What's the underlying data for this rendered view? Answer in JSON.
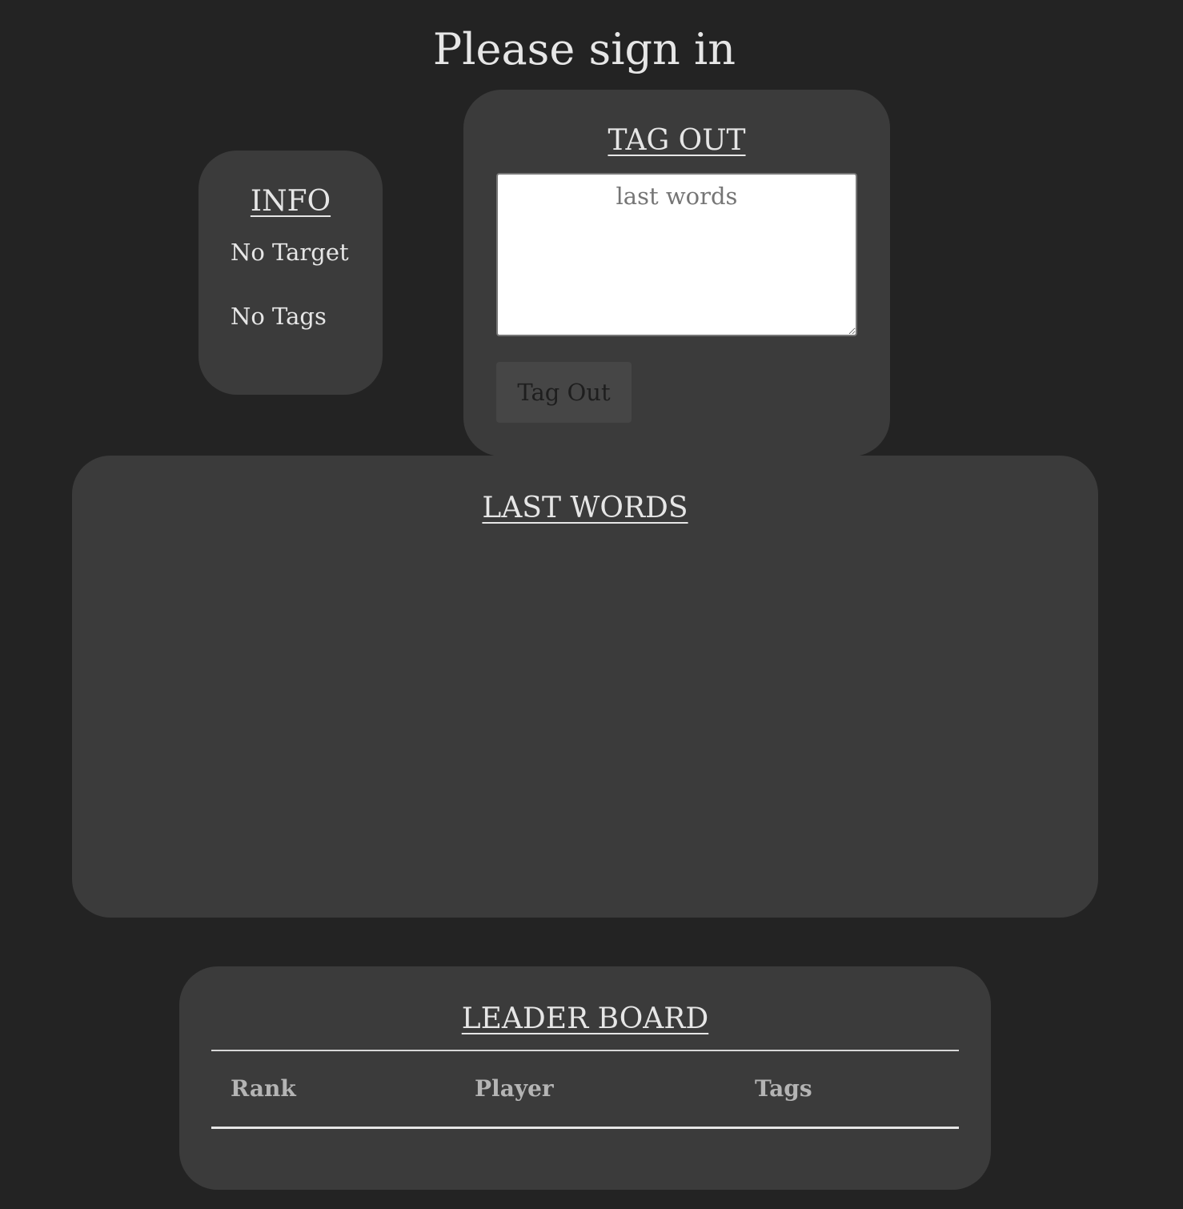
{
  "page": {
    "title": "Please sign in"
  },
  "info": {
    "heading": "INFO",
    "target": "No Target",
    "tags": "No Tags"
  },
  "tag_out": {
    "heading": "TAG OUT",
    "textarea_placeholder": "last words",
    "textarea_value": "",
    "button_label": "Tag Out"
  },
  "last_words": {
    "heading": "LAST WORDS",
    "entries": []
  },
  "leader_board": {
    "heading": "LEADER BOARD",
    "columns": [
      "Rank",
      "Player",
      "Tags"
    ],
    "rows": []
  },
  "colors": {
    "background": "#232323",
    "card": "#3b3b3b",
    "text": "#e6e6e6",
    "header_text": "#b4b4b4",
    "button_bg": "#464646"
  }
}
